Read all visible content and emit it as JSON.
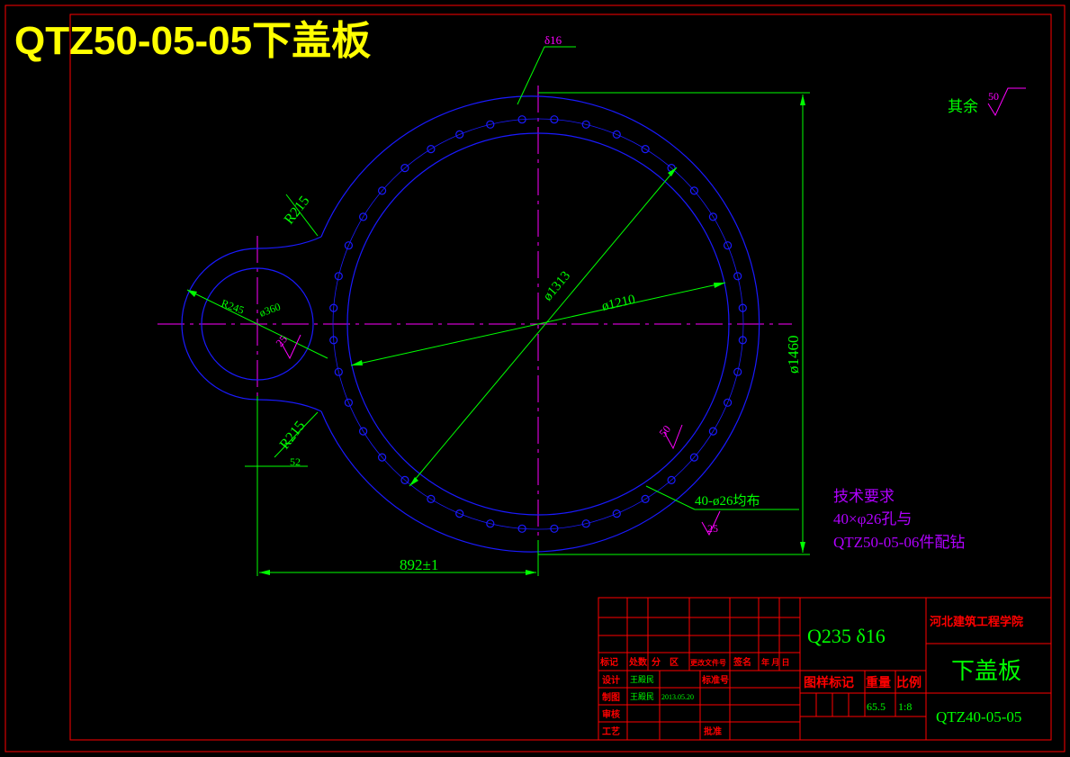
{
  "title": "QTZ50-05-05下盖板",
  "colors": {
    "background": "#000000",
    "frame": "#ff0000",
    "outline": "#1a1aff",
    "dimension": "#00ff00",
    "centerline": "#ff00ff",
    "note": "#b000ff",
    "title": "#ffff00"
  },
  "thickness_callout": "δ16",
  "surface": {
    "prefix": "其余",
    "value": "50"
  },
  "dims": {
    "d1313": "ø1313",
    "d1210": "ø1210",
    "d1460": "ø1460",
    "r215_top": "R215",
    "r215_bottom": "R215",
    "r245": "R245",
    "d360": "ø360",
    "dist": "892±1",
    "small": "52",
    "holes": "40-ø26均布",
    "rough_inner": "25",
    "rough_ring": "50",
    "rough_holes": "25"
  },
  "tech": {
    "heading": "技术要求",
    "line1": "40×φ26孔与",
    "line2": "QTZ50-05-06件配钻"
  },
  "titleblock": {
    "material": "Q235  δ16",
    "school": "河北建筑工程学院",
    "part_name": "下盖板",
    "drawing_no": "QTZ40-05-05",
    "labels": {
      "mark": "标记",
      "count": "处数",
      "zone": "分　区",
      "change_doc": "更改文件号",
      "sign": "签名",
      "date": "年 月 日",
      "design": "设计",
      "standard": "标准号",
      "draw": "制图",
      "check": "审核",
      "process": "工艺",
      "approve": "批准",
      "stage": "图样标记",
      "weight": "重量",
      "scale": "比例"
    },
    "designer": "王殿民",
    "drafter": "王殿民",
    "draft_date": "2013.05.20",
    "weight_value": "65.5",
    "scale_value": "1:8"
  }
}
